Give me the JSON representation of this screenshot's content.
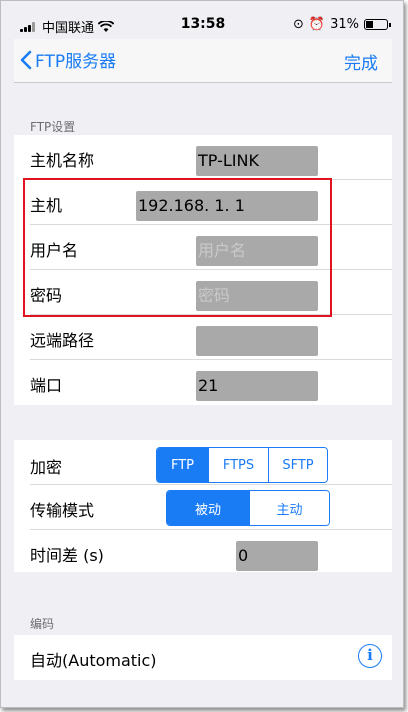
{
  "status_bar": {
    "carrier": "中国联通",
    "time": "13:58",
    "battery_percent": "31%"
  },
  "nav": {
    "back_label": "FTP服务器",
    "done_label": "完成"
  },
  "ftp_settings": {
    "header": "FTP设置",
    "hostname": {
      "label": "主机名称",
      "value": "TP-LINK"
    },
    "host": {
      "label": "主机",
      "value": "192.168. 1. 1"
    },
    "username": {
      "label": "用户名",
      "placeholder": "用户名"
    },
    "password": {
      "label": "密码",
      "placeholder": "密码"
    },
    "remote_path": {
      "label": "远端路径",
      "value": ""
    },
    "port": {
      "label": "端口",
      "value": "21"
    }
  },
  "options": {
    "encryption": {
      "label": "加密",
      "options": [
        "FTP",
        "FTPS",
        "SFTP"
      ],
      "selected": "FTP"
    },
    "transfer_mode": {
      "label": "传输模式",
      "options": [
        "被动",
        "主动"
      ],
      "selected": "被动"
    },
    "time_offset": {
      "label": "时间差 (s)",
      "value": "0"
    }
  },
  "encoding": {
    "header": "编码",
    "value": "自动(Automatic)"
  },
  "colors": {
    "accent": "#1a7cf5",
    "highlight_border": "#e0141e",
    "field_bg": "#a9a9a9"
  }
}
